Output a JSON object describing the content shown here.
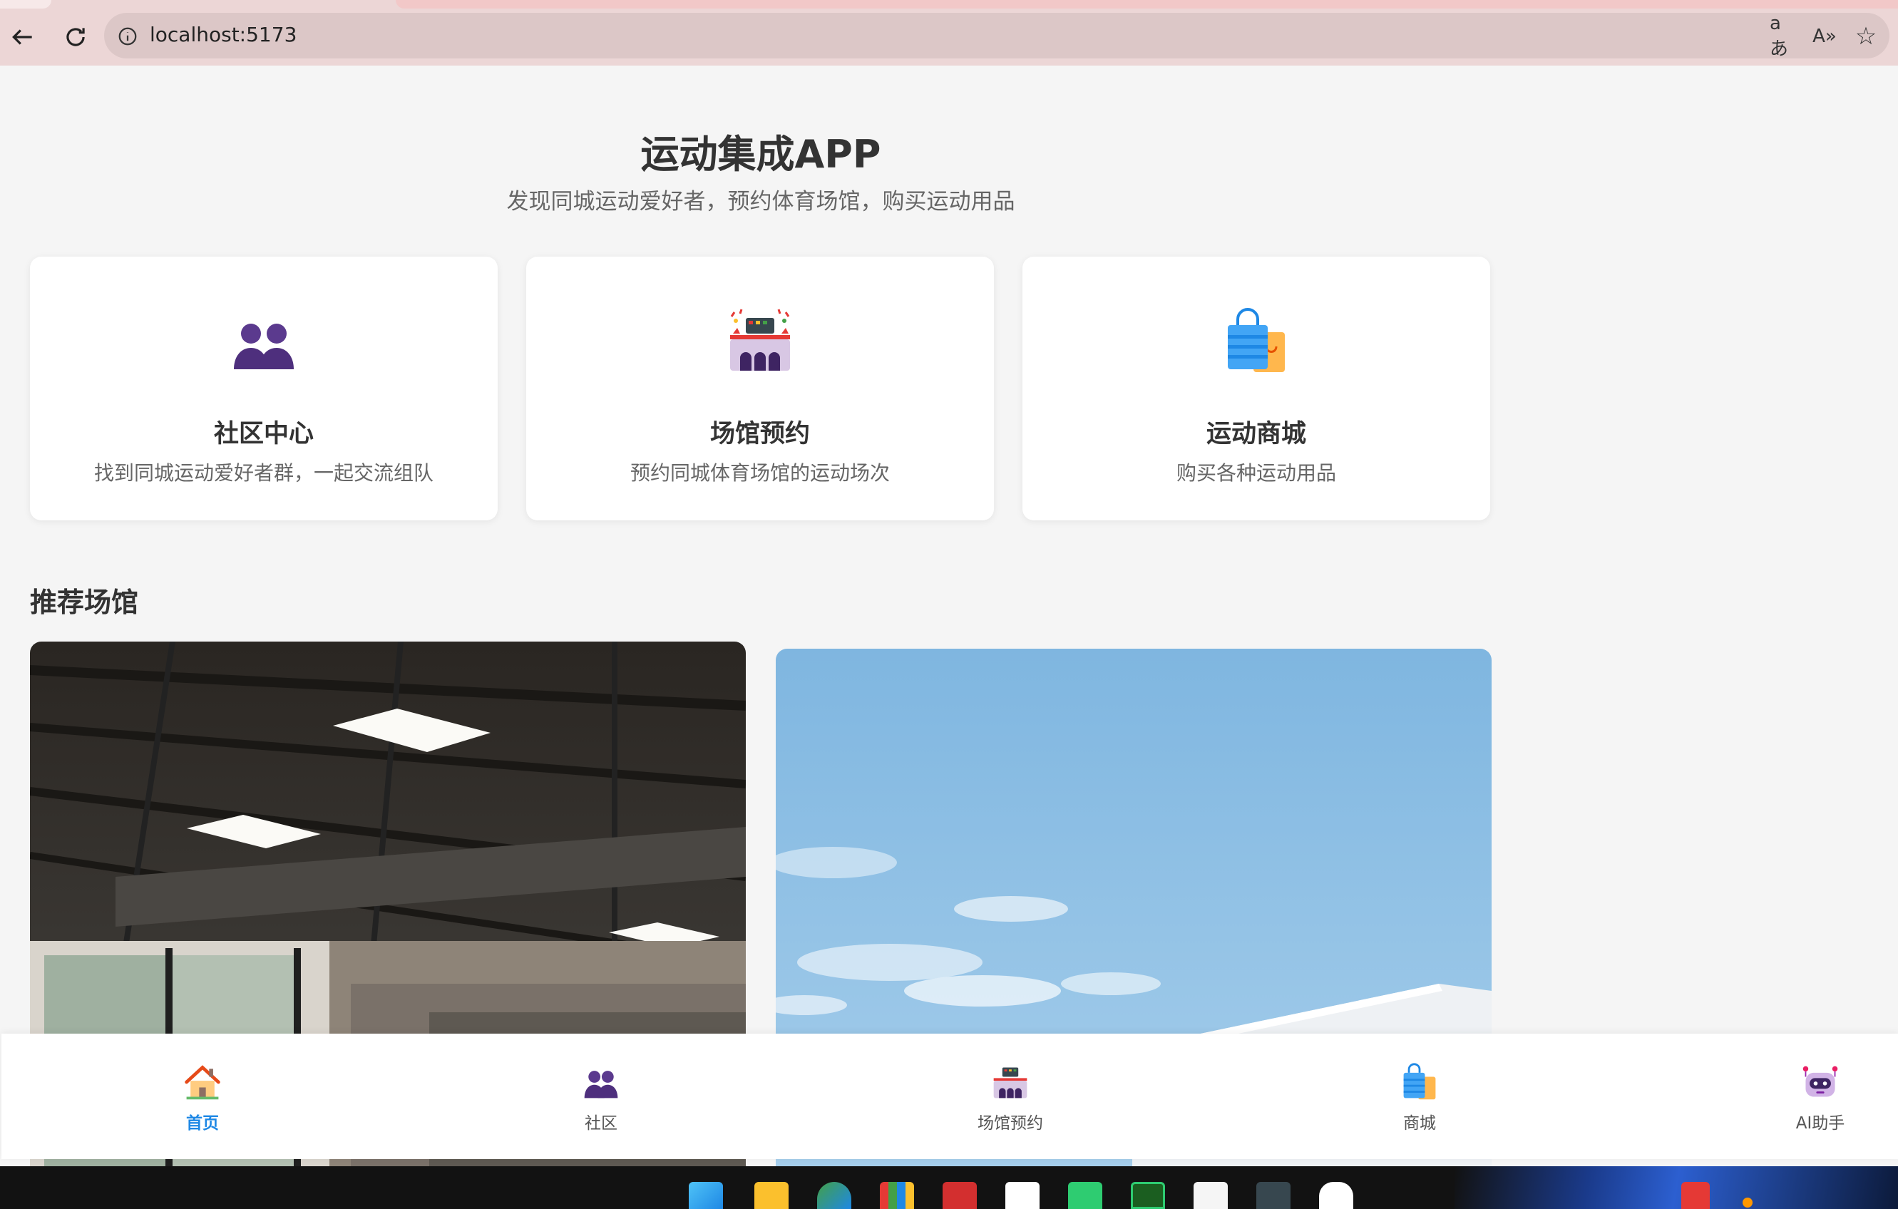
{
  "browser": {
    "url": "localhost:5173",
    "icons": [
      "back-arrow-icon",
      "reload-icon",
      "info-icon",
      "translate-icon",
      "read-aloud-icon",
      "favorite-star-icon"
    ],
    "translate_glyph": "aあ",
    "read_aloud_glyph": "A»",
    "star_glyph": "☆"
  },
  "hero": {
    "title": "运动集成APP",
    "subtitle": "发现同城运动爱好者，预约体育场馆，购买运动用品"
  },
  "features": [
    {
      "icon": "people-icon",
      "title": "社区中心",
      "desc": "找到同城运动爱好者群，一起交流组队"
    },
    {
      "icon": "stadium-icon",
      "title": "场馆预约",
      "desc": "预约同城体育场馆的运动场次"
    },
    {
      "icon": "shopping-bags-icon",
      "title": "运动商城",
      "desc": "购买各种运动用品"
    }
  ],
  "recommended": {
    "title": "推荐场馆",
    "venues": [
      {
        "image": "indoor-gym-photo"
      },
      {
        "image": "outdoor-sky-photo"
      }
    ]
  },
  "bottom_nav": [
    {
      "icon": "house-icon",
      "label": "首页",
      "active": true
    },
    {
      "icon": "people-icon",
      "label": "社区",
      "active": false
    },
    {
      "icon": "stadium-icon",
      "label": "场馆预约",
      "active": false
    },
    {
      "icon": "shopping-bags-icon",
      "label": "商城",
      "active": false
    },
    {
      "icon": "robot-icon",
      "label": "AI助手",
      "active": false
    }
  ],
  "colors": {
    "active_nav": "#1e88e5",
    "page_bg": "#f5f5f5",
    "browser_chrome": "#ecd6d6"
  },
  "taskbar": {
    "icons": [
      "windows-start-icon",
      "file-explorer-icon",
      "edge-browser-icon",
      "microsoft-store-icon",
      "wps-office-icon",
      "cloud-sync-icon",
      "wechat-icon",
      "terminal-green-icon",
      "typora-icon",
      "terminal-icon",
      "qq-penguin-icon",
      "app-tray-icon"
    ]
  }
}
